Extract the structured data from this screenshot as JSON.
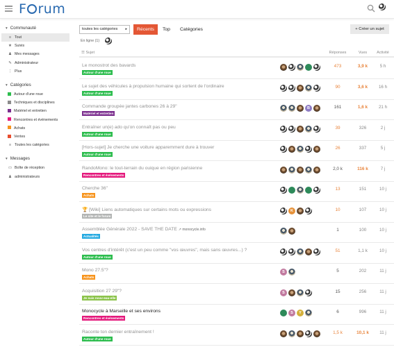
{
  "header": {
    "logo_text_a": "F",
    "logo_text_b": "rum"
  },
  "sidebar": {
    "sections": [
      {
        "title": "Communauté",
        "items": [
          {
            "label": "Tout",
            "icon": "layers-icon",
            "glyph": "≡",
            "active": true
          },
          {
            "label": "Suivis",
            "icon": "star-icon",
            "glyph": "★"
          },
          {
            "label": "Mes messages",
            "icon": "user-icon",
            "glyph": "♟"
          },
          {
            "label": "Administrateur",
            "icon": "wrench-icon",
            "glyph": "✎"
          },
          {
            "label": "Plus",
            "icon": "more-icon",
            "glyph": "⋮"
          }
        ]
      },
      {
        "title": "Catégories",
        "items": [
          {
            "label": "Autour d'une roue",
            "color": "#2dbd4e"
          },
          {
            "label": "Techniques et disciplines",
            "color": "#8c8c8c"
          },
          {
            "label": "Matériel et entretien",
            "color": "#7b2e8e"
          },
          {
            "label": "Rencontres et événements",
            "color": "#e4197c"
          },
          {
            "label": "Achats",
            "color": "#f7941d"
          },
          {
            "label": "Ventes",
            "color": "#e84d2e"
          },
          {
            "label": "Toutes les catégories",
            "icon": "list-icon",
            "glyph": "≡"
          }
        ]
      },
      {
        "title": "Messages",
        "items": [
          {
            "label": "Boîte de réception",
            "icon": "inbox-icon",
            "glyph": "▭"
          },
          {
            "label": "administrateurs",
            "icon": "group-icon",
            "glyph": "♟"
          }
        ]
      }
    ]
  },
  "toolbar": {
    "category_select": "toutes les catégories",
    "tabs": [
      "Récents",
      "Top",
      "Catégories"
    ],
    "create_label": "+ Créer un sujet",
    "online": "En ligne (1)"
  },
  "table": {
    "col_subject": "Sujet",
    "col_replies": "Réponses",
    "col_views": "Vues",
    "col_activity": "Activité",
    "rows": [
      {
        "title": "Le monostrot des bavards",
        "category": "Autour d'une roue",
        "cat_color": "#2dbd4e",
        "replies": "473",
        "views": "3,9 k",
        "activity": "5 h",
        "rep_hot": true,
        "views_hot": true,
        "unread": false,
        "posters": [
          "photo",
          "dark",
          "skate",
          "green",
          "dark"
        ]
      },
      {
        "title": "Le sujet des véhicules à propulsion humaine qui sortent de l'ordinaire",
        "category": "Autour d'une roue",
        "cat_color": "#2dbd4e",
        "replies": "90",
        "views": "3,6 k",
        "activity": "16 h",
        "rep_hot": true,
        "views_hot": true,
        "unread": false,
        "posters": [
          "dark",
          "dark",
          "photo",
          "skate",
          "dark"
        ]
      },
      {
        "title": "Commande groupée jantes carbones 26 à 29\"",
        "category": "Matériel et entretien",
        "cat_color": "#7b2e8e",
        "replies": "161",
        "views": "1,6 k",
        "activity": "21 h",
        "rep_hot": false,
        "views_hot": true,
        "unread": false,
        "posters": [
          "skate",
          "skate",
          "photo",
          "B",
          "photo"
        ]
      },
      {
        "title": "Entraîner un(e) ado qu'on connaît pas ou peu",
        "category": "Autour d'une roue",
        "cat_color": "#2dbd4e",
        "replies": "39",
        "views": "326",
        "activity": "2 j",
        "rep_hot": true,
        "views_hot": false,
        "unread": false,
        "posters": [
          "dark",
          "dark",
          "photo",
          "skate",
          "dark"
        ]
      },
      {
        "title": "[Hors-sujet] Je cherche une voiture apparemment dure à trouver",
        "category": "Autour d'une roue",
        "cat_color": "#2dbd4e",
        "replies": "26",
        "views": "337",
        "activity": "5 j",
        "rep_hot": true,
        "views_hot": false,
        "unread": false,
        "posters": [
          "dark",
          "photo",
          "skate",
          "dark",
          "photo"
        ]
      },
      {
        "title": "RandoMono: le tout-terrain du ouique en région parisienne",
        "category": "Rencontres et événements",
        "cat_color": "#e4197c",
        "replies": "2,0 k",
        "views": "116 k",
        "activity": "7 j",
        "rep_hot": false,
        "views_hot": true,
        "unread": false,
        "posters": [
          "photo",
          "skate",
          "photo",
          "skate",
          "photo"
        ]
      },
      {
        "title": "Cherche 36\"",
        "category": "Achats",
        "cat_color": "#f7941d",
        "replies": "13",
        "views": "151",
        "activity": "10 j",
        "rep_hot": true,
        "views_hot": false,
        "unread": false,
        "posters": [
          "dark",
          "green",
          "skate",
          "green",
          "dark"
        ]
      },
      {
        "title": "🏆 [Wiki] Liens automatiques sur certains mots ou expressions",
        "category": "Le site et le forum",
        "cat_color": "#b3b5b4",
        "replies": "10",
        "views": "107",
        "activity": "10 j",
        "rep_hot": true,
        "views_hot": false,
        "unread": false,
        "posters": [
          "dark",
          "K",
          "photo",
          "dark"
        ]
      },
      {
        "title": "Assemblée Générale 2022 - SAVE THE DATE",
        "ext": "↗ monocycle.info",
        "category": "Actualités",
        "cat_color": "#25aae1",
        "replies": "1",
        "views": "100",
        "activity": "10 j",
        "rep_hot": false,
        "views_hot": false,
        "unread": false,
        "posters": [
          "skate",
          "photo"
        ]
      },
      {
        "title": "Vos centres d'intérêt (c'est un peu comme \"vos œuvres\", mais sans œuvres...) ?",
        "category": "Autour d'une roue",
        "cat_color": "#2dbd4e",
        "replies": "51",
        "views": "1,1 k",
        "activity": "10 j",
        "rep_hot": true,
        "views_hot": false,
        "unread": false,
        "posters": [
          "dark",
          "dark",
          "skate",
          "photo",
          "dark"
        ]
      },
      {
        "title": "Mono 27.5\"?",
        "category": "Achats",
        "cat_color": "#f7941d",
        "replies": "5",
        "views": "202",
        "activity": "11 j",
        "rep_hot": false,
        "views_hot": false,
        "unread": false,
        "posters": [
          "S",
          "skate"
        ]
      },
      {
        "title": "Acquisition 27 29\"?",
        "category": "Je suis nouv-eau-elle",
        "cat_color": "#8bc34a",
        "replies": "15",
        "views": "256",
        "activity": "11 j",
        "rep_hot": false,
        "views_hot": false,
        "unread": false,
        "posters": [
          "S",
          "photo",
          "skate",
          "dark"
        ]
      },
      {
        "title": "Monocycle à Marseille et ses environs",
        "category": "Rencontres et événements",
        "cat_color": "#e4197c",
        "replies": "6",
        "views": "996",
        "activity": "11 j",
        "rep_hot": false,
        "views_hot": false,
        "unread": true,
        "posters": [
          "green",
          "S",
          "Y",
          "skate"
        ]
      },
      {
        "title": "Raconte ton dernier entraînement !",
        "category": "Autour d'une roue",
        "cat_color": "#2dbd4e",
        "replies": "1,5 k",
        "views": "10,1 k",
        "activity": "11 j",
        "rep_hot": true,
        "views_hot": true,
        "unread": false,
        "posters": [
          "photo",
          "skate",
          "photo",
          "dark",
          "photo"
        ]
      }
    ]
  }
}
